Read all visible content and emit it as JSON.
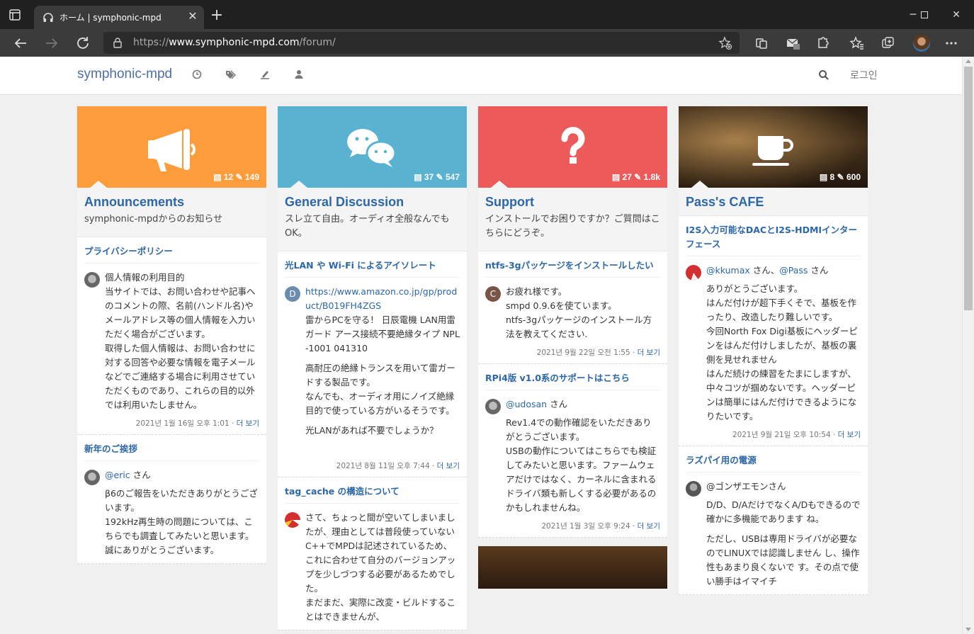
{
  "browser": {
    "tab_title": "ホーム | symphonic-mpd",
    "url_prefix": "https://",
    "url_host": "www.symphonic-mpd.com",
    "url_path": "/forum/"
  },
  "site": {
    "brand": "symphonic-mpd",
    "login": "로그인"
  },
  "columns": [
    {
      "color": "#fd9c3a",
      "icon": "megaphone-icon",
      "topics_count": "12",
      "posts_count": "149",
      "title": "Announcements",
      "desc": "symphonic-mpdからのお知らせ",
      "topics": [
        {
          "title": "プライバシーポリシー",
          "avatar": "cat-avatar",
          "body": [
            "個人情報の利用目的",
            "当サイトでは、お問い合わせや記事へのコメントの際、名前(ハンドル名)やメールアドレス等の個人情報を入力いただく場合がございます。",
            "取得した個人情報は、お問い合わせに対する回答や必要な情報を電子メールなどでご連絡する場合に利用させていただくものであり、これらの目的以外では利用いたしません。"
          ],
          "time": "2021년 1월 16일 오후 1:01",
          "more": "더 보기"
        },
        {
          "title": "新年のご挨拶",
          "avatar": "cat-avatar",
          "mention": "@eric",
          "suffix": " さん",
          "body": [
            "β6のご報告をいただきありがとうございます。",
            "192kHz再生時の問題については、こちらでも調査してみたいと思います。誠にありがとうございます。"
          ],
          "time": "",
          "more": ""
        }
      ]
    },
    {
      "color": "#59b3d0",
      "icon": "chat-bubbles-icon",
      "topics_count": "37",
      "posts_count": "547",
      "title": "General Discussion",
      "desc": "スレ立て自由。オーディオ全般なんでもOK。",
      "topics": [
        {
          "title": "光LAN や Wi-Fi によるアイソレート",
          "avatar": "D",
          "avatar_color": "#6a8caf",
          "link": "https://www.amazon.co.jp/gp/product/B019FH4ZGS",
          "body": [
            "雷からPCを守る！ 日辰電機 LAN用雷ガード アース接続不要絶縁タイプ NPL-1001 041310",
            "高耐圧の絶縁トランスを用いて雷ガードする製品です。",
            "なんでも、オーディオ用にノイズ絶縁目的で使っている方がいるそうです。",
            "光LANがあれば不要でしょうか？"
          ],
          "time": "2021년 8월 11일 오후 7:44",
          "more": "더 보기"
        },
        {
          "title": "tag_cache の構造について",
          "avatar": "spiral-avatar",
          "body": [
            "さて、ちょっと間が空いてしまいましたが、理由としては普段使っていないC++でMPDは記述されているため、これに合わせて自分のバージョンアップを少しづつする必要があるためでした。",
            "まだまだ、実際に改変・ビルドすることはできませんが、"
          ],
          "time": "",
          "more": ""
        }
      ]
    },
    {
      "color": "#ec5a5a",
      "icon": "question-icon",
      "topics_count": "27",
      "posts_count": "1.8k",
      "title": "Support",
      "desc": "インストールでお困りですか？ご質問はこちらにどうぞ。",
      "topics": [
        {
          "title": "ntfs-3gパッケージをインストールしたい",
          "avatar": "C",
          "avatar_color": "#795548",
          "body": [
            "お疲れ様です。",
            "smpd 0.9.6を使ています。",
            "ntfs-3gパッケージのインストール方法を教えてください."
          ],
          "time": "2021년 9월 22일 오전 1:55",
          "more": "더 보기"
        },
        {
          "title": "RPi4版 v1.0系のサポートはこちら",
          "avatar": "cat-avatar",
          "mention": "@udosan",
          "suffix": " さん",
          "body": [
            "Rev1.4での動作確認をいただきありがとうございます。",
            "USBの動作についてはこちらでも検証してみたいと思います。ファームウェアだけではなく、カーネルに含まれるドライバ類も新しくする必要があるのかもしれませんね。"
          ],
          "time": "2021년 1월 3일 오후 9:24",
          "more": "더 보기"
        }
      ]
    },
    {
      "color": "#4a3a28",
      "icon": "coffee-cup-icon",
      "topics_count": "8",
      "posts_count": "600",
      "title": "Pass's CAFE",
      "desc": "",
      "topics": [
        {
          "title": "I2S入力可能なDACとI2S-HDMIインターフェース",
          "avatar": "red-avatar",
          "mention": "@kkumax",
          "suffix": " さん、",
          "mention2": "@Pass",
          "suffix2": " さん",
          "body": [
            "ありがとうございます。",
            "はんだ付けが超下手くそで、基板を作ったり、改造したり難しいです。",
            "今回North Fox Digi基板にヘッダーピンをはんだ付けしましたが、基板の裏側を見せれません",
            "はんだ続けの練習をたまにしますが、中々コツが掴めないです。ヘッダーピンは簡単にはんだ付けできるようになりたいです。"
          ],
          "time": "2021년 9월 21일 오후 10:54",
          "more": "더 보기"
        },
        {
          "title": "ラズパイ用の電源",
          "avatar": "gray-avatar",
          "plain_prefix": "@ゴンザエモンさん",
          "body": [
            "D/D、D/AだけでなくA/Dもできるので確かに多機能であります ね。",
            "ただし、USBは専用ドライバが必要なのでLINUXでは認識しません し、操作性もあまり良くないで す。その点で使い勝手はイマイチ"
          ],
          "time": "",
          "more": ""
        }
      ]
    }
  ]
}
